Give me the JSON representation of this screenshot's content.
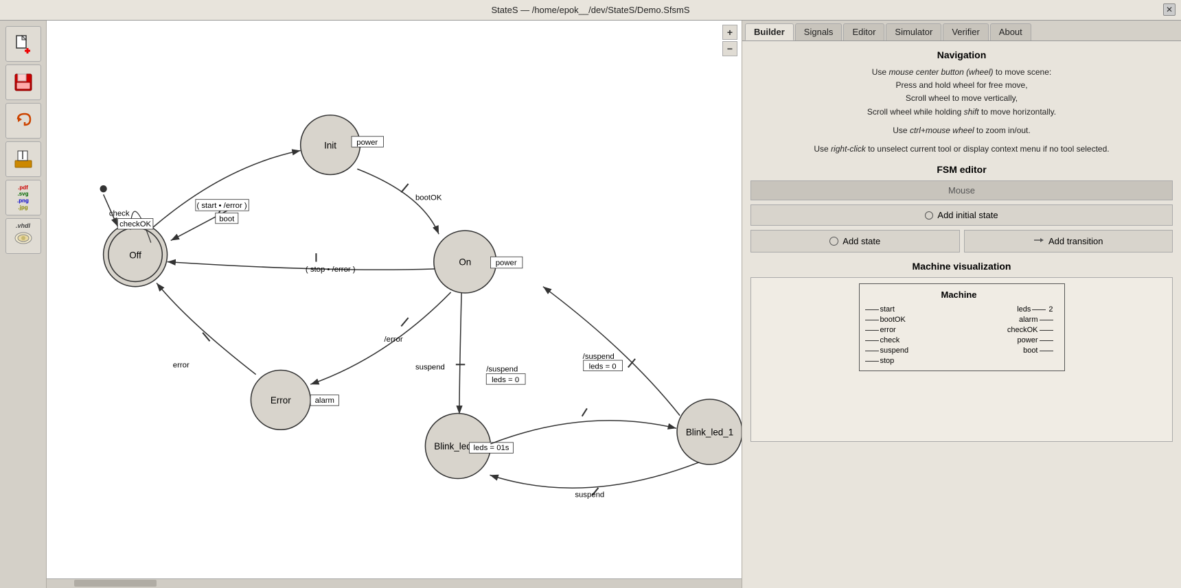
{
  "titlebar": {
    "title": "StateS — /home/epok__/dev/StateS/Demo.SfsmS",
    "close_label": "✕"
  },
  "tabs": [
    {
      "id": "builder",
      "label": "Builder",
      "active": true
    },
    {
      "id": "signals",
      "label": "Signals",
      "active": false
    },
    {
      "id": "editor",
      "label": "Editor",
      "active": false
    },
    {
      "id": "simulator",
      "label": "Simulator",
      "active": false
    },
    {
      "id": "verifier",
      "label": "Verifier",
      "active": false
    },
    {
      "id": "about",
      "label": "About",
      "active": false
    }
  ],
  "navigation": {
    "title": "Navigation",
    "line1": "Use mouse center button (wheel) to move scene:",
    "line2": "Press and hold wheel for free move,",
    "line3": "Scroll wheel to move vertically,",
    "line4": "Scroll wheel while holding shift to move horizontally.",
    "line5": "Use ctrl+mouse wheel to zoom in/out.",
    "line6_pre": "Use ",
    "line6_em": "right-click",
    "line6_post": " to unselect current tool or display context menu if no tool selected."
  },
  "fsm_editor": {
    "title": "FSM editor",
    "mouse_label": "Mouse",
    "add_initial_state_label": "Add initial state",
    "add_state_label": "Add state",
    "add_transition_label": "Add transition"
  },
  "machine_visualization": {
    "title": "Machine visualization",
    "machine_title": "Machine",
    "inputs": [
      "start",
      "bootOK",
      "error",
      "check",
      "suspend",
      "stop"
    ],
    "outputs": [
      "leds",
      "alarm",
      "checkOK",
      "power",
      "boot"
    ],
    "output_num": "2"
  },
  "zoom": {
    "plus": "+",
    "minus": "−"
  },
  "tools": [
    {
      "name": "add-state-tool",
      "icon": "➕",
      "label": ""
    },
    {
      "name": "save-tool",
      "icon": "💾",
      "label": ""
    },
    {
      "name": "undo-tool",
      "icon": "↩",
      "label": ""
    },
    {
      "name": "export-tool",
      "icon": "📤",
      "label": ""
    },
    {
      "name": "pdf-svg-png-jpg",
      "label": ".pdf\n.svg\n.png\n.jpg"
    },
    {
      "name": "vhdl-tool",
      "label": ".vhdl"
    }
  ]
}
